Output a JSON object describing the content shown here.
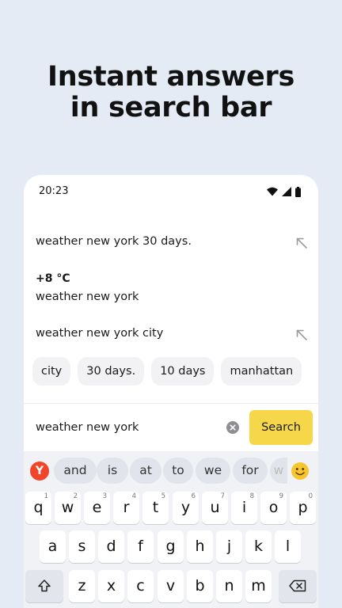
{
  "promo": {
    "headline_line1": "Instant answers",
    "headline_line2": "in search bar"
  },
  "status_bar": {
    "time": "20:23",
    "icons": [
      "wifi-icon",
      "cellular-signal-icon",
      "battery-icon"
    ]
  },
  "suggestions": [
    {
      "text": "weather new york 30 days.",
      "icon": "arrow-up-left-icon"
    },
    {
      "text": "weather new york city",
      "icon": "arrow-up-left-icon"
    }
  ],
  "weather_answer": {
    "temperature": "+8 °C",
    "query": "weather new york"
  },
  "chips": [
    "city",
    "30 days.",
    "10 days",
    "manhattan"
  ],
  "search_bar": {
    "value": "weather new york",
    "clear_icon": "clear-icon",
    "button_label": "Search",
    "button_color": "#f6d74a"
  },
  "keyboard": {
    "logo": "Y",
    "logo_color": "#f0452a",
    "word_suggestions": [
      "and",
      "is",
      "at",
      "to",
      "we",
      "for",
      "w"
    ],
    "emoji_icon": "smiley-icon",
    "row1": [
      {
        "key": "q",
        "hint": "1"
      },
      {
        "key": "w",
        "hint": "2"
      },
      {
        "key": "e",
        "hint": "3"
      },
      {
        "key": "r",
        "hint": "4"
      },
      {
        "key": "t",
        "hint": "5"
      },
      {
        "key": "y",
        "hint": "6"
      },
      {
        "key": "u",
        "hint": "7"
      },
      {
        "key": "i",
        "hint": "8"
      },
      {
        "key": "o",
        "hint": "9"
      },
      {
        "key": "p",
        "hint": "0"
      }
    ],
    "row2": [
      "a",
      "s",
      "d",
      "f",
      "g",
      "h",
      "j",
      "k",
      "l"
    ],
    "row3": [
      "z",
      "x",
      "c",
      "v",
      "b",
      "n",
      "m"
    ],
    "shift_icon": "shift-icon",
    "backspace_icon": "backspace-icon"
  }
}
